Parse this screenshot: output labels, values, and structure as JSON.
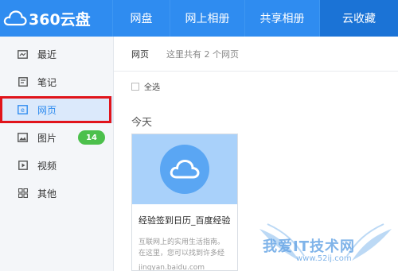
{
  "app": {
    "logo_text": "360云盘"
  },
  "nav": [
    {
      "label": "网盘"
    },
    {
      "label": "网上相册"
    },
    {
      "label": "共享相册"
    },
    {
      "label": "云收藏"
    }
  ],
  "sidebar": {
    "items": [
      {
        "label": "最近",
        "icon": "recent-icon"
      },
      {
        "label": "笔记",
        "icon": "note-icon"
      },
      {
        "label": "网页",
        "icon": "webpage-icon"
      },
      {
        "label": "图片",
        "icon": "image-icon",
        "badge": "14"
      },
      {
        "label": "视频",
        "icon": "video-icon"
      },
      {
        "label": "其他",
        "icon": "grid-icon"
      }
    ]
  },
  "breadcrumb": {
    "current": "网页",
    "count_text": "这里共有 2 个网页"
  },
  "toolbar": {
    "select_all": "全选"
  },
  "section": {
    "title": "今天"
  },
  "card": {
    "title": "经验签到日历_百度经验",
    "desc_line1": "互联网上的实用生活指南。",
    "desc_line2": "在这里，您可以找到许多经",
    "url": "jingyan.baidu.com"
  },
  "watermark": {
    "text": "我爱IT技术网",
    "url": "www.52ij.com"
  },
  "colors": {
    "header": "#2f8cf0",
    "active_nav": "#1b73d6",
    "badge": "#4cc04c",
    "highlight": "#e1141b"
  }
}
